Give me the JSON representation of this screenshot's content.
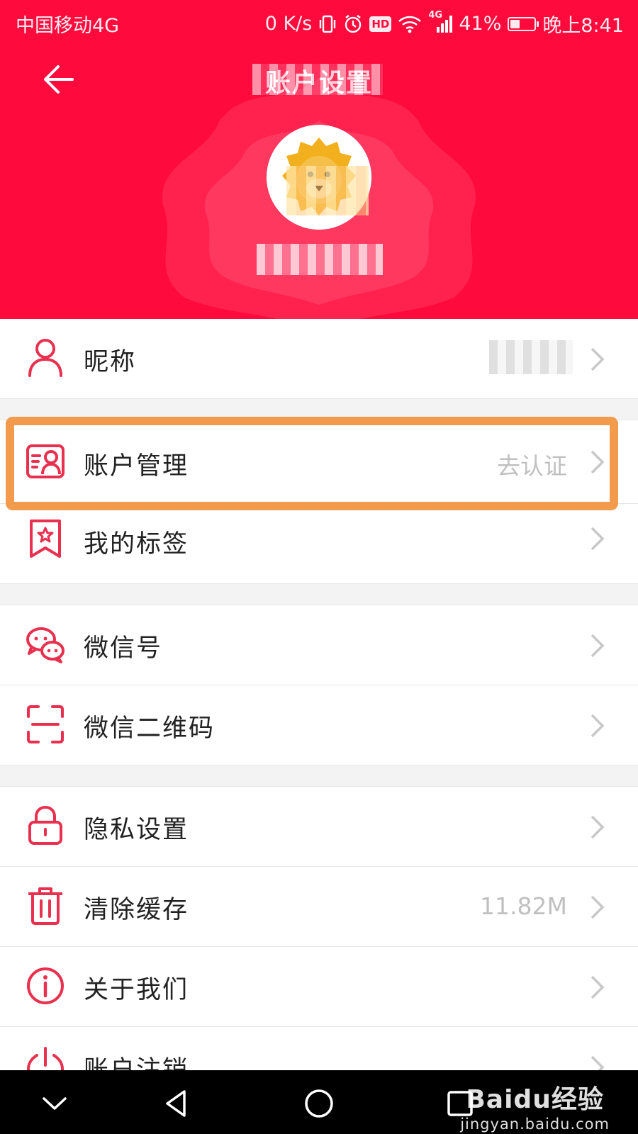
{
  "status_bar": {
    "carrier": "中国移动4G",
    "net_speed": "0 K/s",
    "hd": "HD",
    "network_type": "4G",
    "battery_pct": "41%",
    "battery_level": 0.41,
    "time": "晚上8:41"
  },
  "header": {
    "title": "账户设置",
    "background": "#ff0a3c"
  },
  "rows": {
    "nickname": {
      "label": "昵称",
      "icon": "person-icon"
    },
    "account": {
      "label": "账户管理",
      "value": "去认证",
      "icon": "id-card-icon"
    },
    "tags": {
      "label": "我的标签",
      "icon": "bookmark-star-icon"
    },
    "wechat": {
      "label": "微信号",
      "icon": "wechat-icon"
    },
    "wechat_qr": {
      "label": "微信二维码",
      "icon": "scan-icon"
    },
    "privacy": {
      "label": "隐私设置",
      "icon": "lock-icon"
    },
    "cache": {
      "label": "清除缓存",
      "value": "11.82M",
      "icon": "trash-icon"
    },
    "about": {
      "label": "关于我们",
      "icon": "info-icon"
    },
    "deactivate": {
      "label": "账户注销",
      "icon": "power-icon"
    }
  },
  "colors": {
    "accent": "#e8304f",
    "highlight": "#f39b4d",
    "chevron": "#c8c8c8"
  },
  "watermark": {
    "logo": "Baidu经验",
    "url": "jingyan.baidu.com"
  }
}
